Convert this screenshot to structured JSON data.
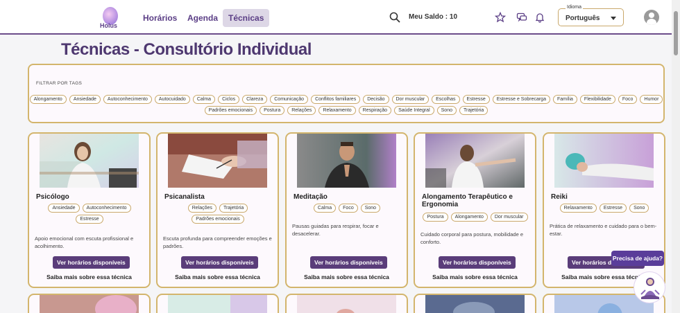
{
  "header": {
    "logo_text": "Holus",
    "nav": [
      {
        "label": "Horários"
      },
      {
        "label": "Agenda"
      },
      {
        "label": "Técnicas"
      }
    ],
    "saldo": "Meu Saldo : 10",
    "language": {
      "label": "Idioma",
      "value": "Português"
    }
  },
  "page": {
    "title": "Técnicas - Consultório Individual"
  },
  "filter": {
    "label": "FILTRAR POR TAGS",
    "row1": [
      "Alongamento",
      "Ansiedade",
      "Autoconhecimento",
      "Autocuidado",
      "Calma",
      "Ciclos",
      "Clareza",
      "Comunicação",
      "Conflitos familiares",
      "Decisão",
      "Dor muscular",
      "Escolhas",
      "Estresse",
      "Estresse e Sobrecarga",
      "Família",
      "Flexibilidade",
      "Foco",
      "Humor"
    ],
    "row2": [
      "Padrões emocionais",
      "Postura",
      "Relações",
      "Relaxamento",
      "Respiração",
      "Saúde Integral",
      "Sono",
      "Trajetória"
    ]
  },
  "cards": [
    {
      "title": "Psicólogo",
      "tags": [
        "Ansiedade",
        "Autoconhecimento",
        "Estresse"
      ],
      "description": "Apoio emocional com escuta profissional e acolhimento.",
      "button": "Ver horários disponíveis",
      "more": "Saiba mais sobre essa técnica"
    },
    {
      "title": "Psicanalista",
      "tags": [
        "Relações",
        "Trajetória",
        "Padrões emocionais"
      ],
      "description": "Escuta profunda para compreender emoções e padrões.",
      "button": "Ver horários disponíveis",
      "more": "Saiba mais sobre essa técnica"
    },
    {
      "title": "Meditação",
      "tags": [
        "Calma",
        "Foco",
        "Sono"
      ],
      "description": "Pausas guiadas para respirar, focar e desacelerar.",
      "button": "Ver horários disponíveis",
      "more": "Saiba mais sobre essa técnica"
    },
    {
      "title": "Alongamento Terapêutico e Ergonomia",
      "tags": [
        "Postura",
        "Alongamento",
        "Dor muscular"
      ],
      "description": "Cuidado corporal para postura, mobilidade e conforto.",
      "button": "Ver horários disponíveis",
      "more": "Saiba mais sobre essa técnica"
    },
    {
      "title": "Reiki",
      "tags": [
        "Relaxamento",
        "Estresse",
        "Sono"
      ],
      "description": "Prática de relaxamento e cuidado para o bem-estar.",
      "button": "Ver horários disponíveis",
      "more": "Saiba mais sobre essa técnica"
    }
  ],
  "help": {
    "label": "Precisa de ajuda?"
  },
  "colors": {
    "accent": "#5a3d7a",
    "border": "#d3b56c",
    "title": "#4e3870"
  }
}
